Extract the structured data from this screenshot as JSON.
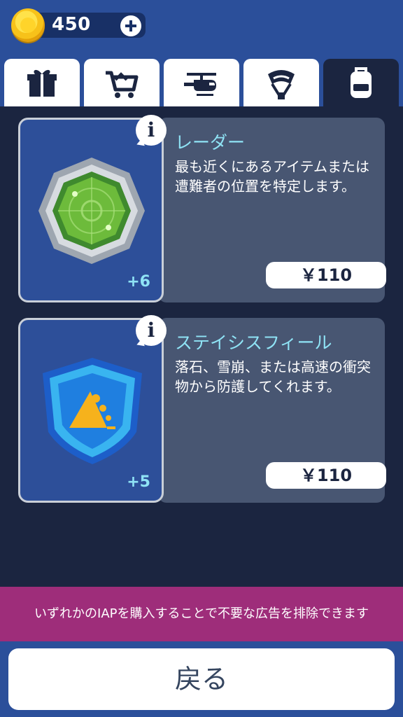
{
  "currency": {
    "amount": "450"
  },
  "tabs": [
    {
      "icon": "gift-icon"
    },
    {
      "icon": "cart-icon"
    },
    {
      "icon": "helicopter-icon"
    },
    {
      "icon": "parachute-icon"
    },
    {
      "icon": "backpack-icon",
      "active": true
    }
  ],
  "items": [
    {
      "icon": "radar-icon",
      "count": "+6",
      "title": "レーダー",
      "description": "最も近くにあるアイテムまたは遭難者の位置を特定します。",
      "price": "￥110"
    },
    {
      "icon": "shield-icon",
      "count": "+5",
      "title": "ステイシスフィール",
      "description": "落石、雪崩、または高速の衝突物から防護してくれます。",
      "price": "￥110"
    }
  ],
  "iap_banner": "いずれかのIAPを購入することで不要な広告を排除できます",
  "back_label": "戻る"
}
